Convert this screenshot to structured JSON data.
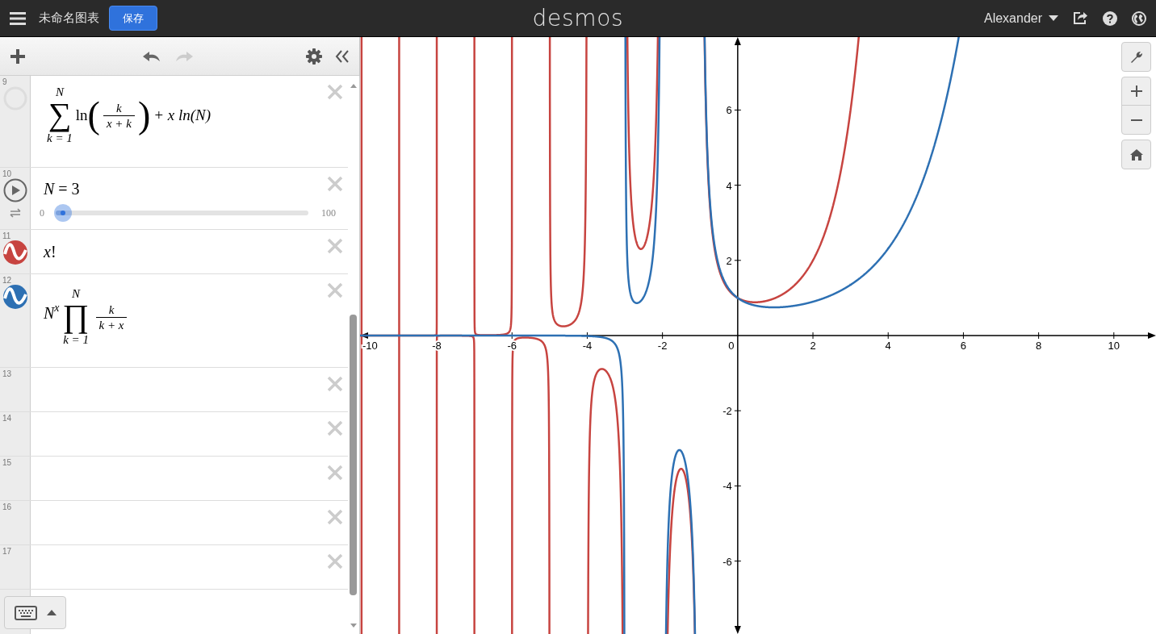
{
  "header": {
    "title": "未命名图表",
    "save_button": "保存",
    "logo": "desmos",
    "user": "Alexander"
  },
  "expressions": [
    {
      "number": "9",
      "kind": "sum",
      "visible": false,
      "symbol": "∑",
      "upper": "*N*",
      "lower": "*k* = 1",
      "func": "ln",
      "open": "(",
      "numerator": "*k*",
      "denominator": "*x* + *k*",
      "close": ")",
      "tail": "+ *x* ln(*N*)"
    },
    {
      "number": "10",
      "kind": "slider",
      "text": "*N* = 3",
      "min": "0",
      "max": "100",
      "level": 0.03
    },
    {
      "number": "11",
      "kind": "plain",
      "visible": true,
      "color": "#c74440",
      "text": "*x*!"
    },
    {
      "number": "12",
      "kind": "product",
      "visible": true,
      "color": "#2d70b3",
      "base": "*N*",
      "exponent": "*x*",
      "symbol": "∏",
      "upper": "*N*",
      "lower": "*k* = 1",
      "numerator": "*k*",
      "denominator": "*k* + *x*"
    },
    {
      "number": "13",
      "kind": "empty"
    },
    {
      "number": "14",
      "kind": "empty"
    },
    {
      "number": "15",
      "kind": "empty"
    },
    {
      "number": "16",
      "kind": "empty"
    },
    {
      "number": "17",
      "kind": "empty"
    }
  ],
  "graph": {
    "x_labels": [
      "-10",
      "-8",
      "-6",
      "-4",
      "-2",
      "0",
      "2",
      "4",
      "6",
      "8",
      "10"
    ],
    "y_labels": [
      "6",
      "4",
      "2",
      "-2",
      "-4",
      "-6"
    ]
  }
}
